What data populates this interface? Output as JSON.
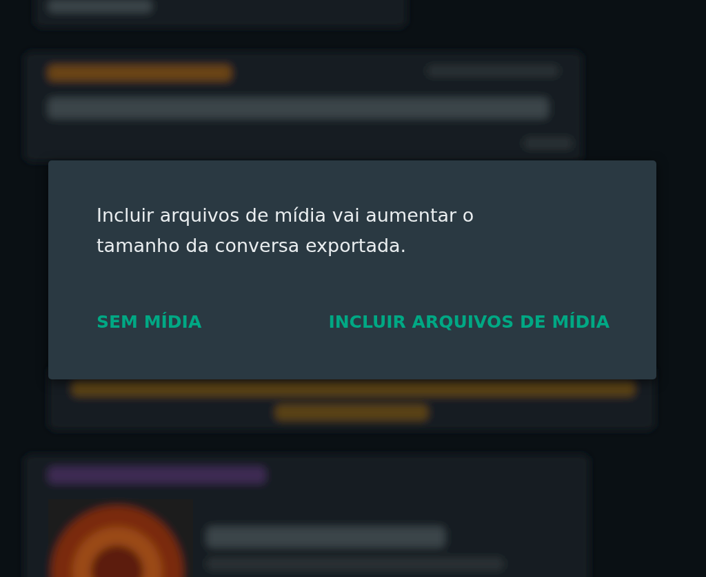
{
  "dialog": {
    "message": "Incluir arquivos de mídia vai aumentar o tamanho da conversa exportada.",
    "buttons": [
      {
        "label": "SEM MÍDIA"
      },
      {
        "label": "INCLUIR ARQUIVOS DE MÍDIA"
      }
    ]
  }
}
